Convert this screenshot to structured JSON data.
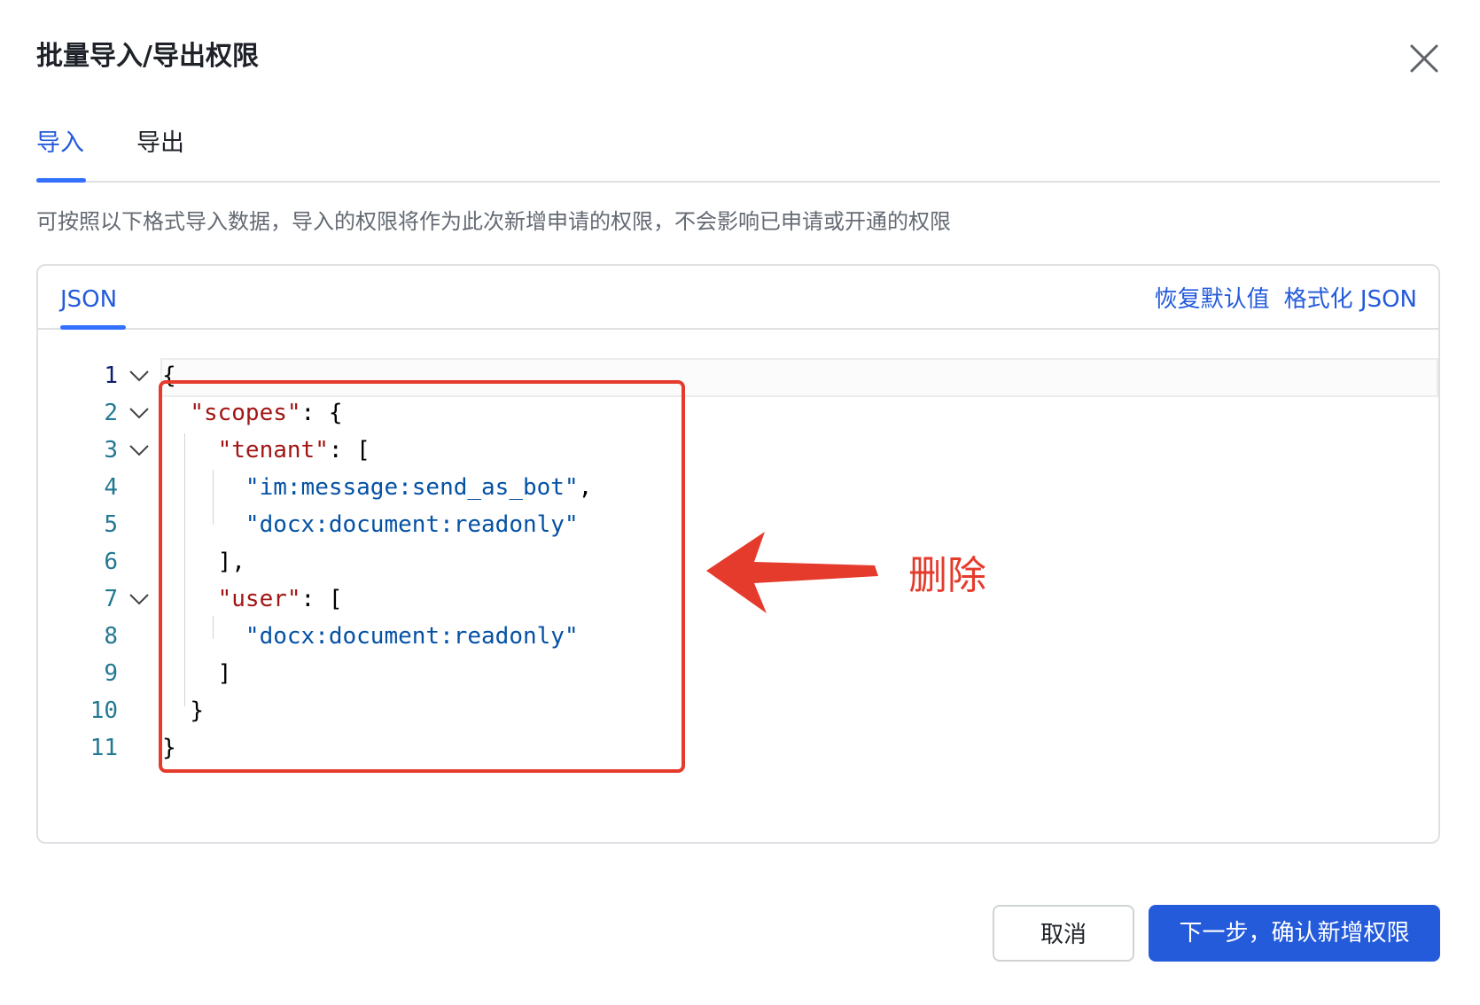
{
  "dialog": {
    "title": "批量导入/导出权限",
    "close_icon": "close-icon"
  },
  "tabs": [
    {
      "label": "导入",
      "active": true
    },
    {
      "label": "导出",
      "active": false
    }
  ],
  "description": "可按照以下格式导入数据，导入的权限将作为此次新增申请的权限，不会影响已申请或开通的权限",
  "editor": {
    "tab_label": "JSON",
    "restore_default_label": "恢复默认值",
    "format_json_label": "格式化 JSON",
    "lines": [
      {
        "num": "1",
        "foldable": true
      },
      {
        "num": "2",
        "foldable": true,
        "key": "\"scopes\"",
        "rest": ": {"
      },
      {
        "num": "3",
        "foldable": true,
        "key": "\"tenant\"",
        "rest": ": ["
      },
      {
        "num": "4",
        "foldable": false,
        "str": "\"im:message:send_as_bot\"",
        "rest": ","
      },
      {
        "num": "5",
        "foldable": false,
        "str": "\"docx:document:readonly\""
      },
      {
        "num": "6",
        "foldable": false,
        "text": "],"
      },
      {
        "num": "7",
        "foldable": true,
        "key": "\"user\"",
        "rest": ": ["
      },
      {
        "num": "8",
        "foldable": false,
        "str": "\"docx:document:readonly\""
      },
      {
        "num": "9",
        "foldable": false,
        "text": "]"
      },
      {
        "num": "10",
        "foldable": false,
        "text": "}"
      },
      {
        "num": "11",
        "foldable": false,
        "text": "}"
      }
    ],
    "first_line_text": "{"
  },
  "annotation": {
    "label": "删除",
    "color": "#e53b2c"
  },
  "footer": {
    "cancel_label": "取消",
    "next_label": "下一步，确认新增权限"
  },
  "colors": {
    "accent": "#245bdb",
    "json_key": "#a31515",
    "json_string": "#0451a5"
  }
}
